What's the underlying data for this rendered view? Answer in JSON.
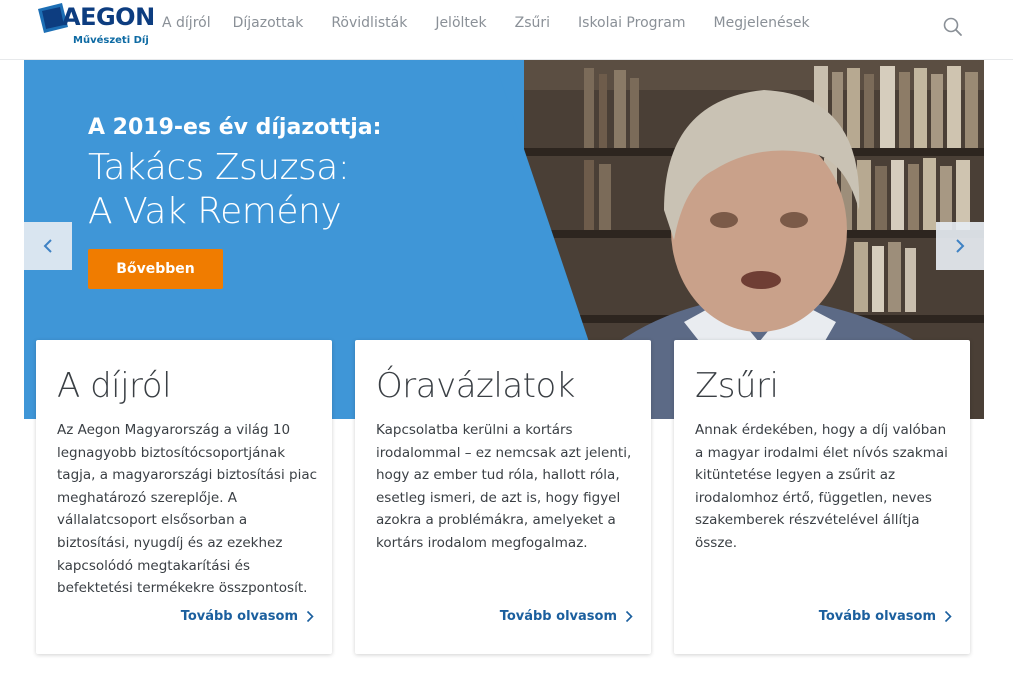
{
  "header": {
    "logo_text": "AEGON",
    "logo_subtitle": "Művészeti Díj",
    "nav": [
      {
        "label": "A díjról"
      },
      {
        "label": "Díjazottak"
      },
      {
        "label": "Rövidlisták"
      },
      {
        "label": "Jelöltek"
      },
      {
        "label": "Zsűri"
      },
      {
        "label": "Iskolai Program"
      },
      {
        "label": "Megjelenések"
      }
    ],
    "search_icon": "search-icon"
  },
  "hero": {
    "label": "A 2019-es év díjazottja:",
    "title_line1": "Takács Zsuzsa:",
    "title_line2": "A Vak Remény",
    "button_label": "Bővebben",
    "prev_icon": "chevron-left-icon",
    "next_icon": "chevron-right-icon",
    "colors": {
      "panel": "#3f96d7",
      "button": "#f07c00"
    }
  },
  "cards": [
    {
      "title": "A díjról",
      "text": "Az Aegon Magyarország a világ 10 legnagyobb biztosítócsoportjának tagja, a magyarországi biztosítási piac meghatározó szereplője. A vállalatcsoport elsősorban a biztosítási, nyugdíj és az ezekhez kapcsolódó megtakarítási és befektetési termékekre összpontosít.",
      "link": "Tovább olvasom"
    },
    {
      "title": "Óravázlatok",
      "text": "Kapcsolatba kerülni a kortárs irodalommal – ez nemcsak azt jelenti, hogy az ember tud róla, hallott róla, esetleg ismeri, de azt is, hogy figyel azokra a problémákra, amelyeket a kortárs irodalom megfogalmaz.",
      "link": "Tovább olvasom"
    },
    {
      "title": "Zsűri",
      "text": "Annak érdekében, hogy a díj valóban a magyar irodalmi élet nívós szakmai kitüntetése legyen a zsűrit az irodalomhoz értő, független, neves szakemberek részvételével állítja össze.",
      "link": "Tovább olvasom"
    }
  ]
}
